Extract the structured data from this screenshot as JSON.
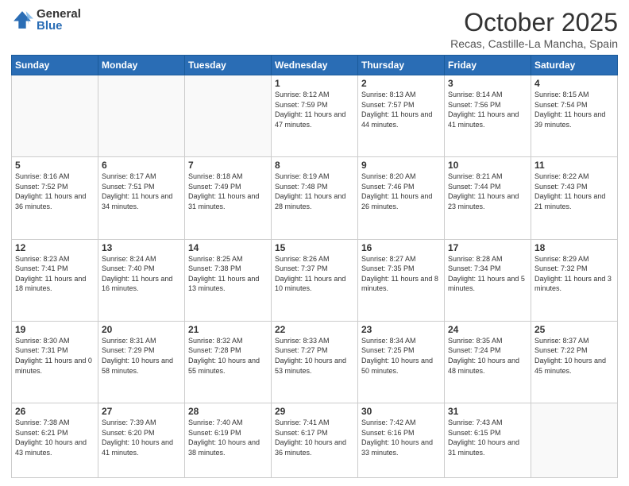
{
  "logo": {
    "general": "General",
    "blue": "Blue"
  },
  "header": {
    "month": "October 2025",
    "location": "Recas, Castille-La Mancha, Spain"
  },
  "days": [
    "Sunday",
    "Monday",
    "Tuesday",
    "Wednesday",
    "Thursday",
    "Friday",
    "Saturday"
  ],
  "weeks": [
    [
      {
        "day": "",
        "info": ""
      },
      {
        "day": "",
        "info": ""
      },
      {
        "day": "",
        "info": ""
      },
      {
        "day": "1",
        "info": "Sunrise: 8:12 AM\nSunset: 7:59 PM\nDaylight: 11 hours\nand 47 minutes."
      },
      {
        "day": "2",
        "info": "Sunrise: 8:13 AM\nSunset: 7:57 PM\nDaylight: 11 hours\nand 44 minutes."
      },
      {
        "day": "3",
        "info": "Sunrise: 8:14 AM\nSunset: 7:56 PM\nDaylight: 11 hours\nand 41 minutes."
      },
      {
        "day": "4",
        "info": "Sunrise: 8:15 AM\nSunset: 7:54 PM\nDaylight: 11 hours\nand 39 minutes."
      }
    ],
    [
      {
        "day": "5",
        "info": "Sunrise: 8:16 AM\nSunset: 7:52 PM\nDaylight: 11 hours\nand 36 minutes."
      },
      {
        "day": "6",
        "info": "Sunrise: 8:17 AM\nSunset: 7:51 PM\nDaylight: 11 hours\nand 34 minutes."
      },
      {
        "day": "7",
        "info": "Sunrise: 8:18 AM\nSunset: 7:49 PM\nDaylight: 11 hours\nand 31 minutes."
      },
      {
        "day": "8",
        "info": "Sunrise: 8:19 AM\nSunset: 7:48 PM\nDaylight: 11 hours\nand 28 minutes."
      },
      {
        "day": "9",
        "info": "Sunrise: 8:20 AM\nSunset: 7:46 PM\nDaylight: 11 hours\nand 26 minutes."
      },
      {
        "day": "10",
        "info": "Sunrise: 8:21 AM\nSunset: 7:44 PM\nDaylight: 11 hours\nand 23 minutes."
      },
      {
        "day": "11",
        "info": "Sunrise: 8:22 AM\nSunset: 7:43 PM\nDaylight: 11 hours\nand 21 minutes."
      }
    ],
    [
      {
        "day": "12",
        "info": "Sunrise: 8:23 AM\nSunset: 7:41 PM\nDaylight: 11 hours\nand 18 minutes."
      },
      {
        "day": "13",
        "info": "Sunrise: 8:24 AM\nSunset: 7:40 PM\nDaylight: 11 hours\nand 16 minutes."
      },
      {
        "day": "14",
        "info": "Sunrise: 8:25 AM\nSunset: 7:38 PM\nDaylight: 11 hours\nand 13 minutes."
      },
      {
        "day": "15",
        "info": "Sunrise: 8:26 AM\nSunset: 7:37 PM\nDaylight: 11 hours\nand 10 minutes."
      },
      {
        "day": "16",
        "info": "Sunrise: 8:27 AM\nSunset: 7:35 PM\nDaylight: 11 hours\nand 8 minutes."
      },
      {
        "day": "17",
        "info": "Sunrise: 8:28 AM\nSunset: 7:34 PM\nDaylight: 11 hours\nand 5 minutes."
      },
      {
        "day": "18",
        "info": "Sunrise: 8:29 AM\nSunset: 7:32 PM\nDaylight: 11 hours\nand 3 minutes."
      }
    ],
    [
      {
        "day": "19",
        "info": "Sunrise: 8:30 AM\nSunset: 7:31 PM\nDaylight: 11 hours\nand 0 minutes."
      },
      {
        "day": "20",
        "info": "Sunrise: 8:31 AM\nSunset: 7:29 PM\nDaylight: 10 hours\nand 58 minutes."
      },
      {
        "day": "21",
        "info": "Sunrise: 8:32 AM\nSunset: 7:28 PM\nDaylight: 10 hours\nand 55 minutes."
      },
      {
        "day": "22",
        "info": "Sunrise: 8:33 AM\nSunset: 7:27 PM\nDaylight: 10 hours\nand 53 minutes."
      },
      {
        "day": "23",
        "info": "Sunrise: 8:34 AM\nSunset: 7:25 PM\nDaylight: 10 hours\nand 50 minutes."
      },
      {
        "day": "24",
        "info": "Sunrise: 8:35 AM\nSunset: 7:24 PM\nDaylight: 10 hours\nand 48 minutes."
      },
      {
        "day": "25",
        "info": "Sunrise: 8:37 AM\nSunset: 7:22 PM\nDaylight: 10 hours\nand 45 minutes."
      }
    ],
    [
      {
        "day": "26",
        "info": "Sunrise: 7:38 AM\nSunset: 6:21 PM\nDaylight: 10 hours\nand 43 minutes."
      },
      {
        "day": "27",
        "info": "Sunrise: 7:39 AM\nSunset: 6:20 PM\nDaylight: 10 hours\nand 41 minutes."
      },
      {
        "day": "28",
        "info": "Sunrise: 7:40 AM\nSunset: 6:19 PM\nDaylight: 10 hours\nand 38 minutes."
      },
      {
        "day": "29",
        "info": "Sunrise: 7:41 AM\nSunset: 6:17 PM\nDaylight: 10 hours\nand 36 minutes."
      },
      {
        "day": "30",
        "info": "Sunrise: 7:42 AM\nSunset: 6:16 PM\nDaylight: 10 hours\nand 33 minutes."
      },
      {
        "day": "31",
        "info": "Sunrise: 7:43 AM\nSunset: 6:15 PM\nDaylight: 10 hours\nand 31 minutes."
      },
      {
        "day": "",
        "info": ""
      }
    ]
  ]
}
